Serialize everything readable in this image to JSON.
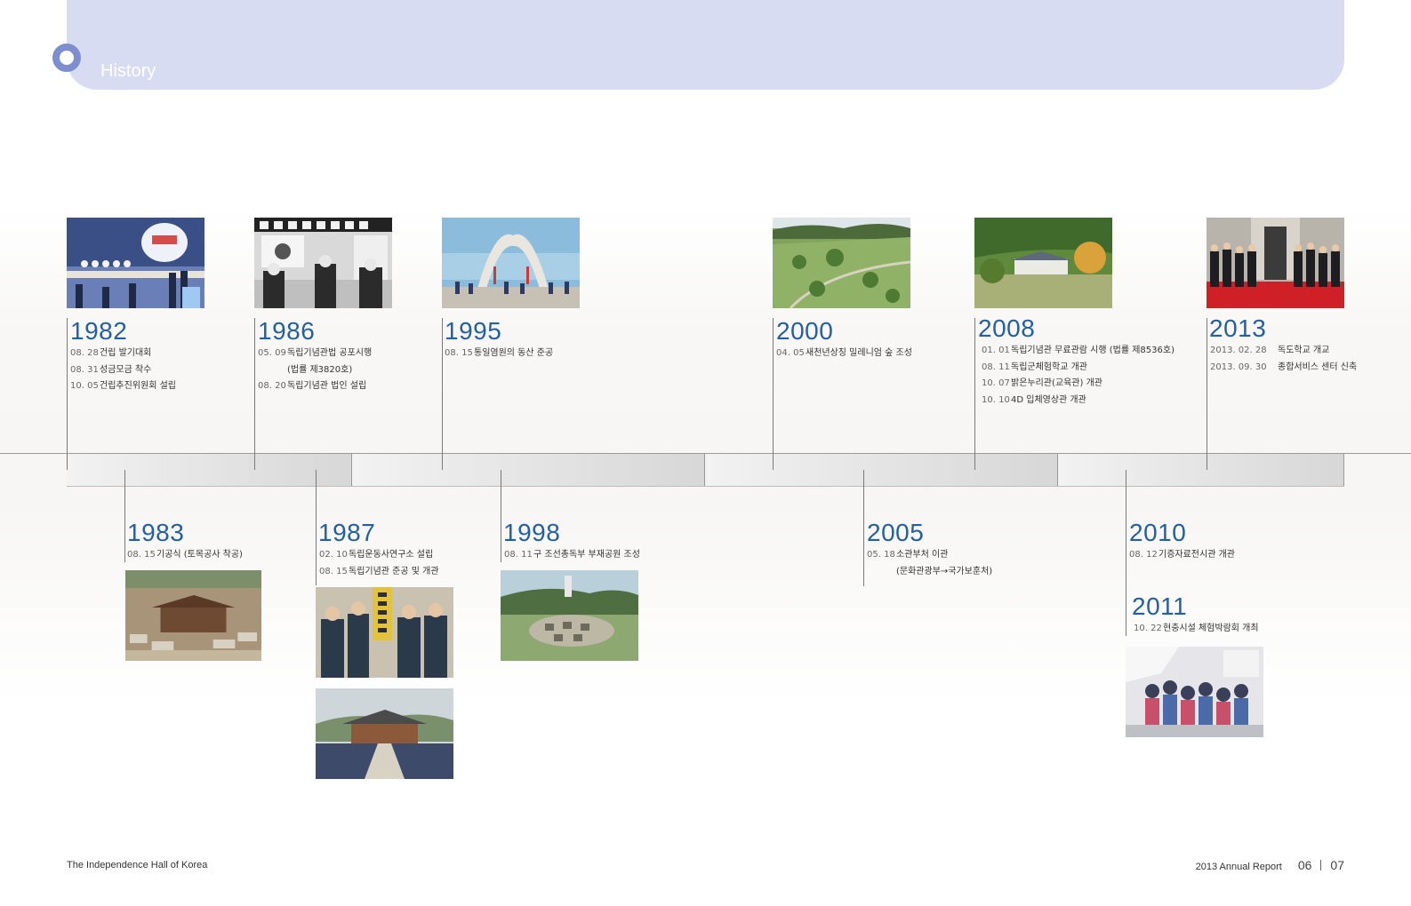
{
  "header": {
    "title": "History"
  },
  "footer": {
    "left": "The Independence Hall of Korea",
    "report": "2013 Annual Report",
    "page_left": "06",
    "page_right": "07"
  },
  "colors": {
    "accent": "#245fa2",
    "header_band": "#d7dcf3",
    "header_ring": "#7d8fce"
  },
  "timeline": {
    "y1982": {
      "year": "1982",
      "events": [
        {
          "date": "08. 28",
          "text": "건립 발기대회"
        },
        {
          "date": "08. 31",
          "text": "성금모금 착수"
        },
        {
          "date": "10. 05",
          "text": "건립추진위원회 설립"
        }
      ]
    },
    "y1983": {
      "year": "1983",
      "events": [
        {
          "date": "08. 15",
          "text": "기공식 (토목공사 착공)"
        }
      ]
    },
    "y1986": {
      "year": "1986",
      "events": [
        {
          "date": "05. 09",
          "text": "독립기념관법 공포시행"
        },
        {
          "date": "",
          "text": "(법률 제3820호)"
        },
        {
          "date": "08. 20",
          "text": "독립기념관 법인 설립"
        }
      ]
    },
    "y1987": {
      "year": "1987",
      "events": [
        {
          "date": "02. 10",
          "text": "독립운동사연구소 설립"
        },
        {
          "date": "08. 15",
          "text": "독립기념관 준공 및 개관"
        }
      ]
    },
    "y1995": {
      "year": "1995",
      "events": [
        {
          "date": "08. 15",
          "text": "통일염원의 동산 준공"
        }
      ]
    },
    "y1998": {
      "year": "1998",
      "events": [
        {
          "date": "08. 11",
          "text": "구 조선총독부 부재공원 조성"
        }
      ]
    },
    "y2000": {
      "year": "2000",
      "events": [
        {
          "date": "04. 05",
          "text": "새천년상징 밀레니엄 숲 조성"
        }
      ]
    },
    "y2005": {
      "year": "2005",
      "events": [
        {
          "date": "05. 18",
          "text": "소관부처 이관"
        },
        {
          "date": "",
          "text": "(문화관광부→국가보훈처)"
        }
      ]
    },
    "y2008": {
      "year": "2008",
      "events": [
        {
          "date": "01. 01",
          "text": "독립기념관 무료관람 시행 (법률 제8536호)"
        },
        {
          "date": "08. 11",
          "text": "독립군체험학교 개관"
        },
        {
          "date": "10. 07",
          "text": "밝은누리관(교육관) 개관"
        },
        {
          "date": "10. 10",
          "text": "4D 입체영상관 개관"
        }
      ]
    },
    "y2010": {
      "year": "2010",
      "events": [
        {
          "date": "08. 12",
          "text": "기증자료전시관 개관"
        }
      ]
    },
    "y2011": {
      "year": "2011",
      "events": [
        {
          "date": "10. 22",
          "text": "현충시설 체험박람회 개최"
        }
      ]
    },
    "y2013": {
      "year": "2013",
      "events": [
        {
          "date": "2013. 02. 28",
          "text": "독도학교 개교"
        },
        {
          "date": "2013. 09. 30",
          "text": "종합서비스 센터 신축"
        }
      ]
    }
  }
}
